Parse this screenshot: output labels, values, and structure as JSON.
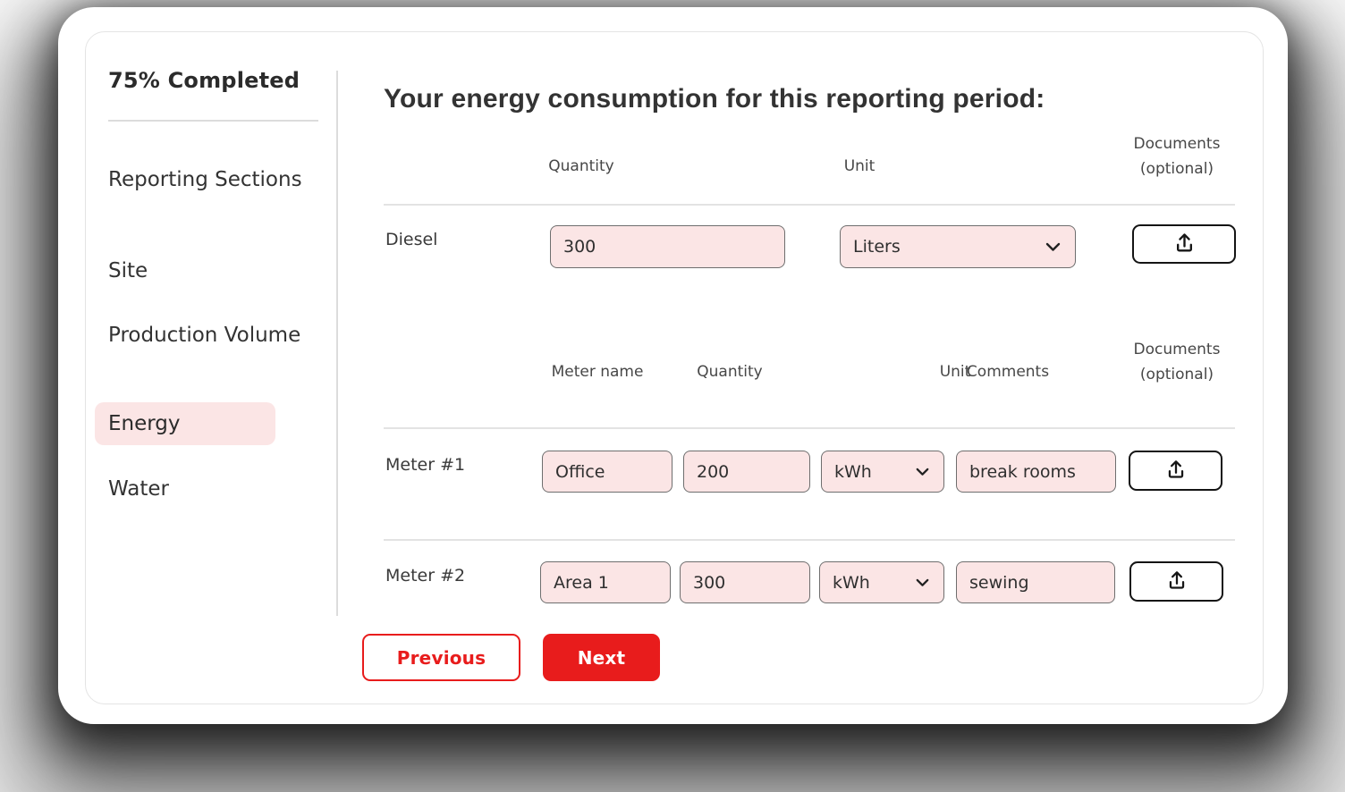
{
  "sidebar": {
    "progress": "75% Completed",
    "items": [
      {
        "label": "Reporting Sections",
        "active": false
      },
      {
        "label": "Site",
        "active": false
      },
      {
        "label": "Production Volume",
        "active": false
      },
      {
        "label": "Energy",
        "active": true
      },
      {
        "label": "Water",
        "active": false
      }
    ]
  },
  "main": {
    "heading": "Your energy consumption for this reporting period:",
    "fuel_table": {
      "headers": {
        "quantity": "Quantity",
        "unit": "Unit",
        "documents_line1": "Documents",
        "documents_line2": "(optional)"
      },
      "row": {
        "label": "Diesel",
        "quantity_value": "300",
        "unit_value": "Liters"
      }
    },
    "meters_table": {
      "headers": {
        "meter_name": "Meter name",
        "quantity": "Quantity",
        "unit": "Unit",
        "comments": "Comments",
        "documents_line1": "Documents",
        "documents_line2": "(optional)"
      },
      "rows": [
        {
          "label": "Meter #1",
          "meter_name": "Office",
          "quantity": "200",
          "unit": "kWh",
          "comments": "break rooms"
        },
        {
          "label": "Meter #2",
          "meter_name": "Area 1",
          "quantity": "300",
          "unit": "kWh",
          "comments": "sewing"
        }
      ]
    },
    "buttons": {
      "previous": "Previous",
      "next": "Next"
    }
  },
  "icons": {
    "upload": "upload-icon",
    "chevron": "chevron-down-icon"
  },
  "colors": {
    "accent_red": "#e81c1c",
    "pink_fill": "#fbe5e5",
    "text_dark": "#333333",
    "text_gray": "#474747",
    "divider": "#e3e3e3"
  }
}
